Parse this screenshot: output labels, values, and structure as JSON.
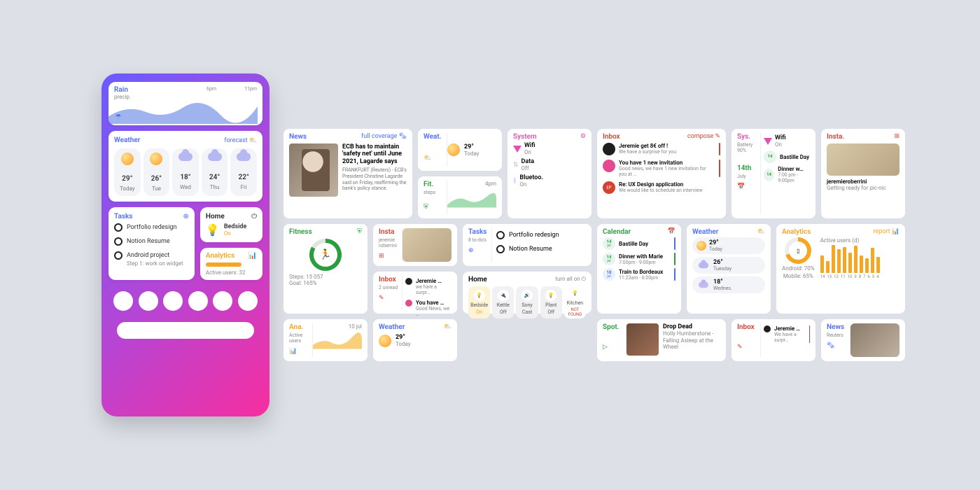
{
  "phone": {
    "rain": {
      "title": "Rain",
      "subtitle": "precip.",
      "ticks": [
        "6pm",
        "11pm"
      ]
    },
    "weather": {
      "title": "Weather",
      "action": "forecast",
      "days": [
        {
          "temp": "29°",
          "label": "Today",
          "icon": "sun"
        },
        {
          "temp": "26°",
          "label": "Tue",
          "icon": "sun"
        },
        {
          "temp": "18°",
          "label": "Wed",
          "icon": "cloud"
        },
        {
          "temp": "24°",
          "label": "Thu",
          "icon": "cloud"
        },
        {
          "temp": "22°",
          "label": "Fri",
          "icon": "cloud"
        }
      ]
    },
    "tasks": {
      "title": "Tasks",
      "items": [
        {
          "label": "Portfolio redesign"
        },
        {
          "label": "Notion Resume"
        },
        {
          "label": "Android project",
          "sub": "Step 1: work on widget"
        }
      ]
    },
    "home": {
      "title": "Home",
      "device": "Bedside",
      "state": "On"
    },
    "analytics": {
      "title": "Analytics",
      "line": "Active users: 32"
    }
  },
  "grid": {
    "news": {
      "title": "News",
      "action": "full coverage",
      "headline": "ECB has to maintain 'safety net' until June 2021, Lagarde says",
      "body": "FRANKFURT (Reuters) - ECB's President Christine Lagarde said on Friday, reaffirming the bank's policy stance."
    },
    "weat": {
      "title": "Weat.",
      "temp": "29°",
      "day": "Today"
    },
    "fit": {
      "title": "Fit.",
      "sub": "steps",
      "tick": "4pm"
    },
    "system": {
      "title": "System",
      "rows": [
        {
          "name": "Wifi",
          "state": "On",
          "color": "#e050b0"
        },
        {
          "name": "Data",
          "state": "Off",
          "color": "#bbb"
        },
        {
          "name": "Bluetoo.",
          "state": "On",
          "color": "#b38bff"
        }
      ]
    },
    "inbox": {
      "title": "Inbox",
      "action": "compose",
      "msgs": [
        {
          "avatar": "#1f1f1f",
          "title": "Jeremie get 8€ off !",
          "sub": "We have a surprise for you"
        },
        {
          "avatar": "#e44a8d",
          "title": "You have 1 new invitation",
          "sub": "Good news, we have 1 new invitation for you at …"
        },
        {
          "avatar": "#d6402f",
          "title": "Re: UX Design application",
          "sub": "We would like to schedule an interview"
        }
      ]
    },
    "sys2": {
      "title": "Sys.",
      "sub": "Battery 90%",
      "wifi": "Wifi",
      "wifi_state": "On",
      "date_day": "14th",
      "date_mon": "July",
      "events": [
        {
          "name": "Bastille Day"
        },
        {
          "name": "Dinner w…",
          "time": "7:00 pm - 9:00pm"
        }
      ]
    },
    "insta_lg": {
      "title": "Insta.",
      "user": "jeremieroberrini",
      "caption": "Getting ready for pic-nic"
    },
    "fitness": {
      "title": "Fitness",
      "steps": "Steps: 15 057",
      "goal": "Goal: 165%"
    },
    "insta_sm": {
      "title": "Insta",
      "user": "jeremie roberrini"
    },
    "tasks2": {
      "title": "Tasks",
      "sub": "8 to-do's",
      "items": [
        "Portfolio redesign",
        "Notion Resume"
      ]
    },
    "inbox_sm": {
      "title": "Inbox",
      "sub": "2 unread",
      "msgs": [
        {
          "title": "Jeremie …",
          "sub": "we hare a surpr…"
        },
        {
          "title": "You have …",
          "sub": "Good News, we …"
        }
      ]
    },
    "calendar": {
      "title": "Calendar",
      "rows": [
        {
          "d": "14",
          "m": "jul",
          "title": "Bastille Day",
          "sub": "",
          "bar": "#4b6cff"
        },
        {
          "d": "14",
          "m": "jul",
          "title": "Dinner with Marie",
          "sub": "7:00pm - 9:00pm",
          "bar": "#2a9d3e"
        },
        {
          "d": "18",
          "m": "jul",
          "title": "Train to Bordeaux",
          "sub": "11:23am - 6:00pm",
          "bar": "#4b6cff"
        }
      ]
    },
    "weather2": {
      "title": "Weather",
      "rows": [
        {
          "icon": "sun",
          "temp": "29°",
          "day": "Today"
        },
        {
          "icon": "cloud",
          "temp": "26°",
          "day": "Tuesday"
        },
        {
          "icon": "cloud2",
          "temp": "18°",
          "day": "Wednes."
        }
      ]
    },
    "analytics2": {
      "title": "Analytics",
      "action": "report",
      "sub": "Active users (d)",
      "android": "Android: 70%",
      "mobile": "Mobile: 65%",
      "ticks": [
        "14",
        "13",
        "12",
        "11",
        "10",
        "9",
        "8",
        "7",
        "6",
        "5",
        "4"
      ]
    },
    "home": {
      "title": "Home",
      "action": "turn all on",
      "tiles": [
        {
          "name": "Bedside",
          "state": "On",
          "on": true
        },
        {
          "name": "Kettle",
          "state": "Off"
        },
        {
          "name": "Sony",
          "state": "Cast"
        },
        {
          "name": "Plant",
          "state": "Off"
        },
        {
          "name": "Kitchen",
          "state": "NOT FOUND",
          "err": true
        }
      ]
    },
    "ana_sm": {
      "title": "Ana.",
      "sub": "Active users",
      "date": "10 jul"
    },
    "weather_sm": {
      "title": "Weather",
      "temp": "29°",
      "day": "Today"
    },
    "spot": {
      "title": "Spot.",
      "track": "Drop Dead",
      "artist": "Holly Humberstone - Falling Asleep at the Wheel"
    },
    "inbox3": {
      "title": "Inbox",
      "msg_title": "Jeremie …",
      "msg_sub": "We have a surpr…"
    },
    "news2": {
      "title": "News",
      "source": "Reuters"
    }
  },
  "colors": {
    "blue": "#4b6cff",
    "red": "#d6402f",
    "green": "#2a9d3e",
    "orange": "#f5a623",
    "pink": "#e050b0",
    "purple": "#b38bff"
  }
}
